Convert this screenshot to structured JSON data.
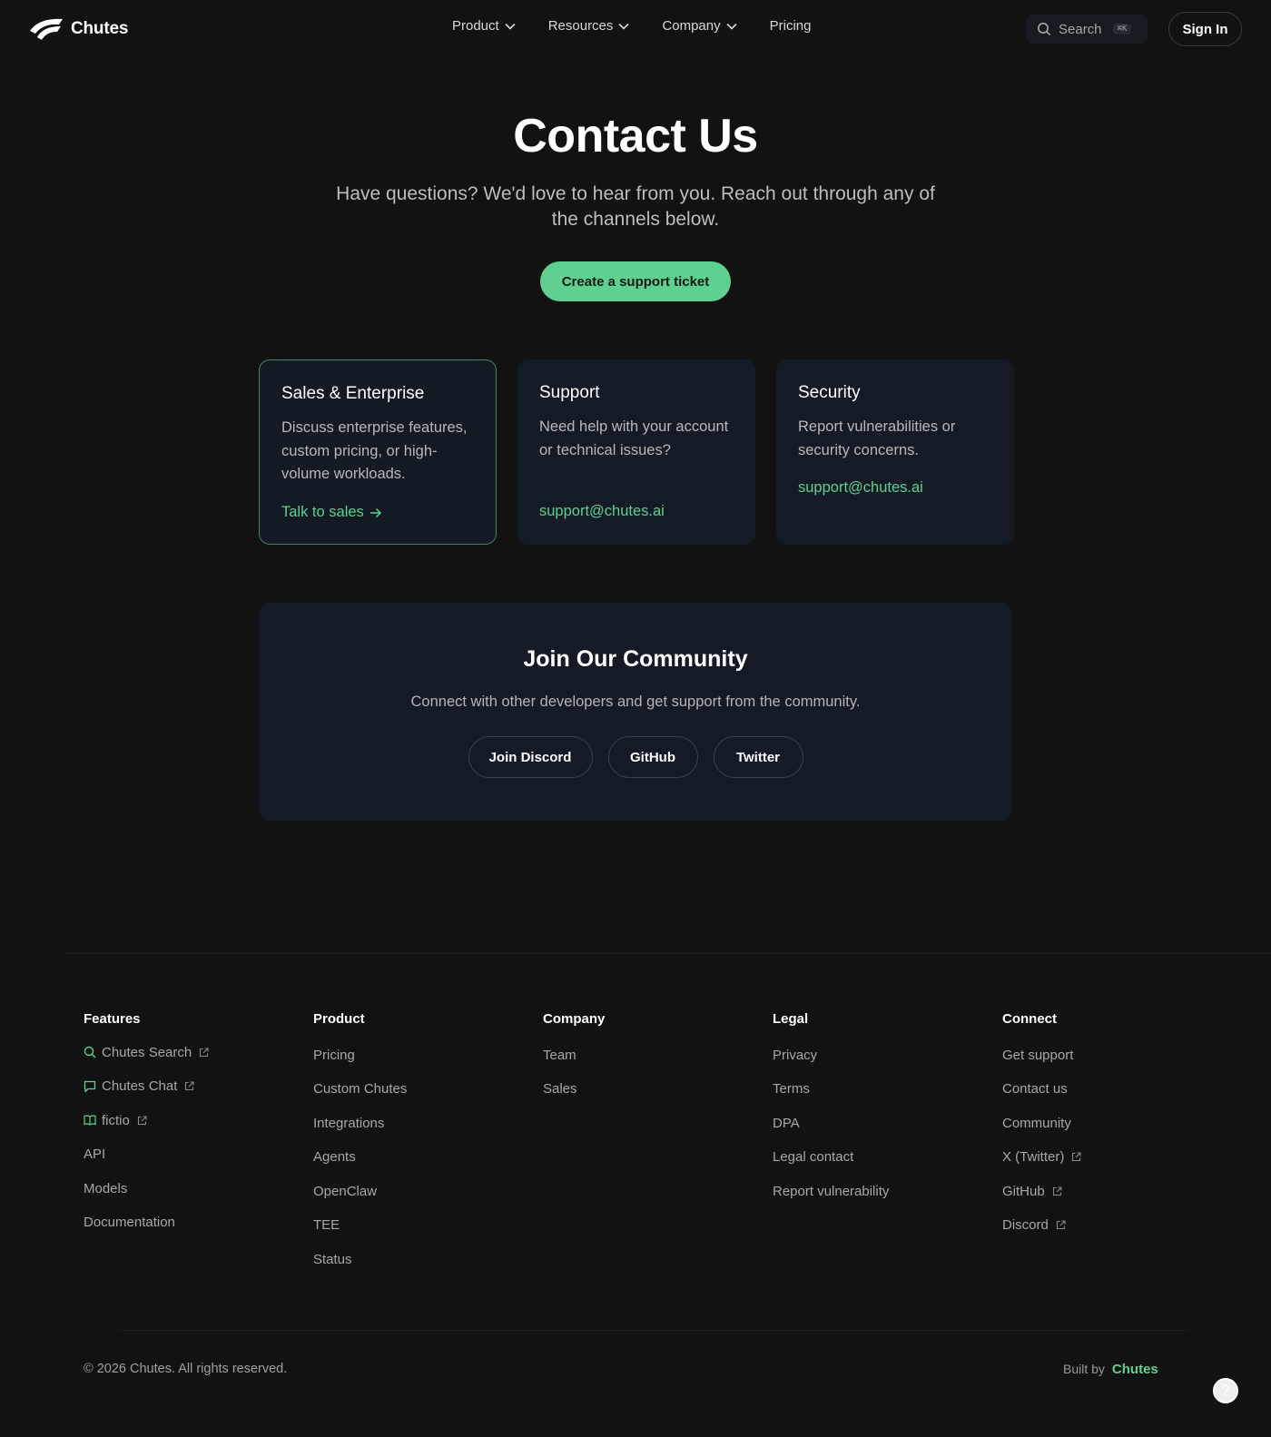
{
  "header": {
    "brand": "Chutes",
    "nav": [
      {
        "label": "Product",
        "has_dropdown": true
      },
      {
        "label": "Resources",
        "has_dropdown": true
      },
      {
        "label": "Company",
        "has_dropdown": true
      },
      {
        "label": "Pricing",
        "has_dropdown": false
      }
    ],
    "search_label": "Search",
    "search_shortcut": "⌘K",
    "signin_label": "Sign In"
  },
  "hero": {
    "title": "Contact Us",
    "subtitle": "Have questions? We'd love to hear from you. Reach out through any of the channels below.",
    "cta_label": "Create a support ticket"
  },
  "cards": [
    {
      "title": "Sales & Enterprise",
      "description": "Discuss enterprise features, custom pricing, or high-volume workloads.",
      "link": "Talk to sales",
      "link_arrow": true
    },
    {
      "title": "Support",
      "description": "Need help with your account or technical issues?",
      "link": "support@chutes.ai"
    },
    {
      "title": "Security",
      "description": "Report vulnerabilities or security concerns.",
      "link": "support@chutes.ai"
    }
  ],
  "community": {
    "title": "Join Our Community",
    "subtitle": "Connect with other developers and get support from the community.",
    "buttons": [
      "Join Discord",
      "GitHub",
      "Twitter"
    ]
  },
  "footer": {
    "columns": [
      {
        "title": "Features",
        "links": [
          {
            "label": "Chutes Search",
            "icon": "search-icon",
            "external": true
          },
          {
            "label": "Chutes Chat",
            "icon": "chat-icon",
            "external": true
          },
          {
            "label": "fictio",
            "icon": "book-icon",
            "external": true
          },
          {
            "label": "API"
          },
          {
            "label": "Models"
          },
          {
            "label": "Documentation"
          }
        ]
      },
      {
        "title": "Product",
        "links": [
          {
            "label": "Pricing"
          },
          {
            "label": "Custom Chutes"
          },
          {
            "label": "Integrations"
          },
          {
            "label": "Agents"
          },
          {
            "label": "OpenClaw"
          },
          {
            "label": "TEE"
          },
          {
            "label": "Status"
          }
        ]
      },
      {
        "title": "Company",
        "links": [
          {
            "label": "Team"
          },
          {
            "label": "Sales"
          }
        ]
      },
      {
        "title": "Legal",
        "links": [
          {
            "label": "Privacy"
          },
          {
            "label": "Terms"
          },
          {
            "label": "DPA"
          },
          {
            "label": "Legal contact"
          },
          {
            "label": "Report vulnerability"
          }
        ]
      },
      {
        "title": "Connect",
        "links": [
          {
            "label": "Get support"
          },
          {
            "label": "Contact us"
          },
          {
            "label": "Community"
          },
          {
            "label": "X (Twitter)",
            "external": true
          },
          {
            "label": "GitHub",
            "external": true
          },
          {
            "label": "Discord",
            "external": true
          }
        ]
      }
    ],
    "copyright": "© 2026 Chutes. All rights reserved.",
    "built_by_label": "Built by",
    "built_by_brand": "Chutes",
    "help_glyph": "?"
  },
  "colors": {
    "background": "#121212",
    "accent": "#5fd08f",
    "card_bg": "#141b27"
  }
}
